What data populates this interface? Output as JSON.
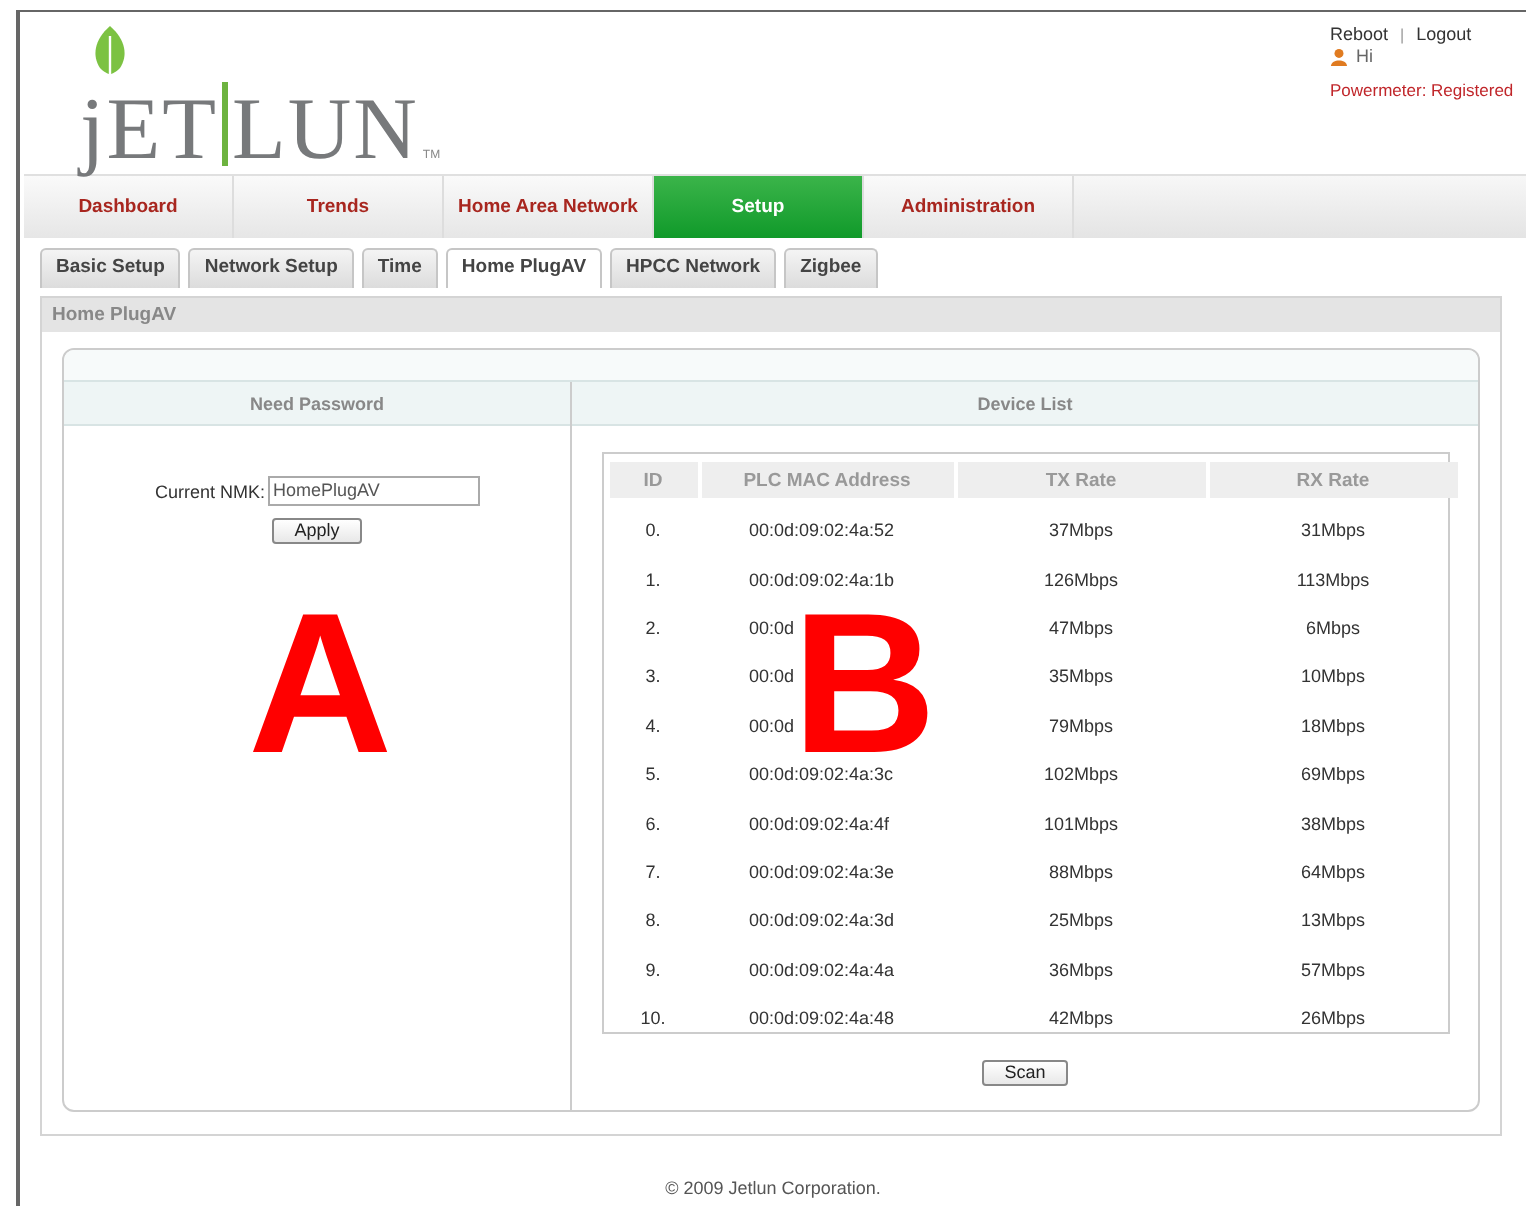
{
  "logo": {
    "left": "jET",
    "right": "LUN",
    "mark": "TM"
  },
  "header": {
    "links": [
      "Reboot",
      "Logout"
    ],
    "separator": "|",
    "greeting": "Hi",
    "status": "Powermeter: Registered"
  },
  "nav": [
    {
      "label": "Dashboard",
      "selected": false
    },
    {
      "label": "Trends",
      "selected": false
    },
    {
      "label": "Home Area Network",
      "selected": false
    },
    {
      "label": "Setup",
      "selected": true
    },
    {
      "label": "Administration",
      "selected": false
    }
  ],
  "subtabs": [
    {
      "label": "Basic Setup",
      "selected": false
    },
    {
      "label": "Network Setup",
      "selected": false
    },
    {
      "label": "Time",
      "selected": false
    },
    {
      "label": "Home PlugAV",
      "selected": true
    },
    {
      "label": "HPCC Network",
      "selected": false
    },
    {
      "label": "Zigbee",
      "selected": false
    }
  ],
  "section_title": "Home PlugAV",
  "password_panel": {
    "title": "Need Password",
    "field_label": "Current NMK:",
    "value": "HomePlugAV",
    "button": "Apply"
  },
  "device_list": {
    "title": "Device List",
    "columns": [
      "ID",
      "PLC MAC Address",
      "TX Rate",
      "RX Rate"
    ],
    "rows": [
      [
        "0.",
        "00:0d:09:02:4a:52",
        "37Mbps",
        "31Mbps"
      ],
      [
        "1.",
        "00:0d:09:02:4a:1b",
        "126Mbps",
        "113Mbps"
      ],
      [
        "2.",
        "00:0d",
        "47Mbps",
        "6Mbps"
      ],
      [
        "3.",
        "00:0d",
        "35Mbps",
        "10Mbps"
      ],
      [
        "4.",
        "00:0d",
        "79Mbps",
        "18Mbps"
      ],
      [
        "5.",
        "00:0d:09:02:4a:3c",
        "102Mbps",
        "69Mbps"
      ],
      [
        "6.",
        "00:0d:09:02:4a:4f",
        "101Mbps",
        "38Mbps"
      ],
      [
        "7.",
        "00:0d:09:02:4a:3e",
        "88Mbps",
        "64Mbps"
      ],
      [
        "8.",
        "00:0d:09:02:4a:3d",
        "25Mbps",
        "13Mbps"
      ],
      [
        "9.",
        "00:0d:09:02:4a:4a",
        "36Mbps",
        "57Mbps"
      ],
      [
        "10.",
        "00:0d:09:02:4a:48",
        "42Mbps",
        "26Mbps"
      ]
    ],
    "button": "Scan"
  },
  "annotations": [
    {
      "text": "A"
    },
    {
      "text": "B"
    }
  ],
  "footer": "© 2009 Jetlun Corporation."
}
